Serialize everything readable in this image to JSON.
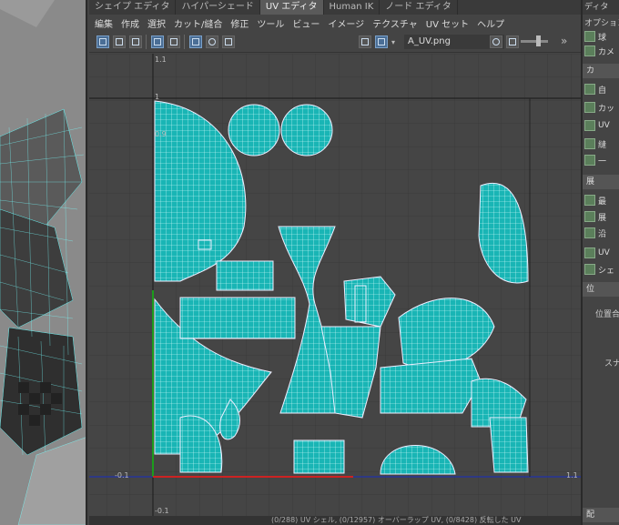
{
  "tabs": [
    "シェイプ エディタ",
    "ハイパーシェード",
    "UV エディタ",
    "Human IK",
    "ノード エディタ"
  ],
  "active_tab": "UV エディタ",
  "menus": [
    "編集",
    "作成",
    "選択",
    "カット/縫合",
    "修正",
    "ツール",
    "ビュー",
    "イメージ",
    "テクスチャ",
    "UV セット",
    "ヘルプ"
  ],
  "texture_name": "A_UV.png",
  "axis_labels": {
    "top_v": "1.1",
    "v_one": "1",
    "v_09": "0.9",
    "left_u": "-0.1",
    "bottom_u": "1.1",
    "below_v": "-0.1"
  },
  "status_text": "(0/288) UV シェル, (0/12957) オーバーラップ UV, (0/8428) 反転した UV",
  "right_panel": {
    "title": "オプション",
    "header_right": "ディタ",
    "sections": [
      "カ",
      "展",
      "位"
    ],
    "items": [
      "球",
      "カメ",
      "自",
      "カッ",
      "UV",
      "縫",
      "一",
      "最",
      "展",
      "沿",
      "UV",
      "シェ"
    ],
    "labels": [
      "位置合",
      "スナ"
    ],
    "bottom": "配"
  },
  "icons": [
    "select-uv-icon",
    "shell-icon",
    "checker-icon",
    "wire-icon",
    "camera-icon",
    "image-icon",
    "pattern-icon",
    "dropdown-icon",
    "globe-icon",
    "settings-icon",
    "expand-icon"
  ]
}
